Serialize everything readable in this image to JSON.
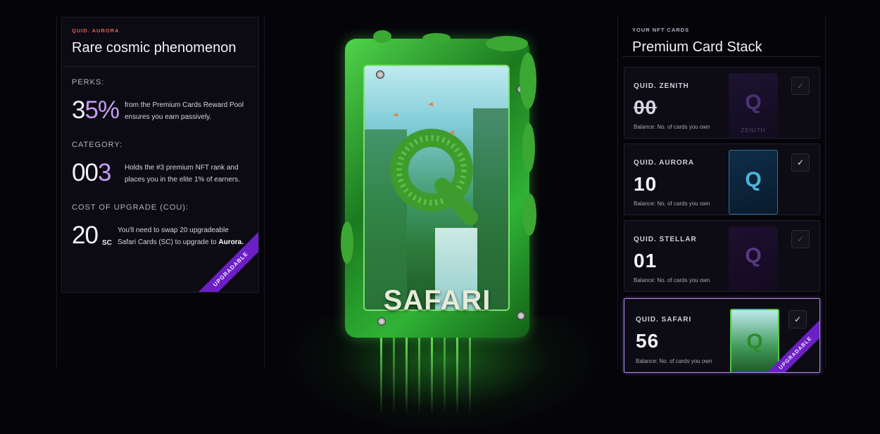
{
  "left_panel": {
    "eyebrow": "QUID. AURORA",
    "title": "Rare cosmic phenomenon",
    "perks": {
      "label": "PERKS:",
      "value": "35%",
      "desc_line1": "from the Premium Cards Reward Pool",
      "desc_line2": "ensures you earn passively."
    },
    "category": {
      "label": "CATEGORY:",
      "value": "003",
      "desc_line1": "Holds the #3 premium NFT rank and",
      "desc_line2": "places you in the elite 1% of earners."
    },
    "cost": {
      "label": "COST OF UPGRADE (COU):",
      "value": "20",
      "unit": "SC",
      "desc_line1": "You'll need to swap 20 upgradeable",
      "desc_line2_pre": "Safari Cards (SC) to upgrade to ",
      "desc_line2_bold": "Aurora."
    },
    "ribbon": "UPGRADABLE"
  },
  "center_card": {
    "label": "SAFARI",
    "colors": {
      "frame": "#2fb335",
      "glow": "#4fd44a"
    }
  },
  "right_panel": {
    "eyebrow": "YOUR NFT CARDS",
    "title": "Premium Card Stack",
    "balance_label": "Balance: No. of cards you own",
    "cards": [
      {
        "name": "QUID. ZENITH",
        "count": "00",
        "thumb_caption": "ZENITH",
        "thumb_letter": "Q",
        "check": "✓"
      },
      {
        "name": "QUID. AURORA",
        "count": "10",
        "thumb_letter": "Q",
        "check": "✓"
      },
      {
        "name": "QUID. STELLAR",
        "count": "01",
        "thumb_letter": "Q",
        "check": "✓"
      },
      {
        "name": "QUID. SAFARI",
        "count": "56",
        "thumb_letter": "Q",
        "check": "✓",
        "ribbon": "UPGRADABLE"
      }
    ]
  },
  "icons": {
    "check": "check-icon",
    "q_logo": "q-logo-icon"
  }
}
